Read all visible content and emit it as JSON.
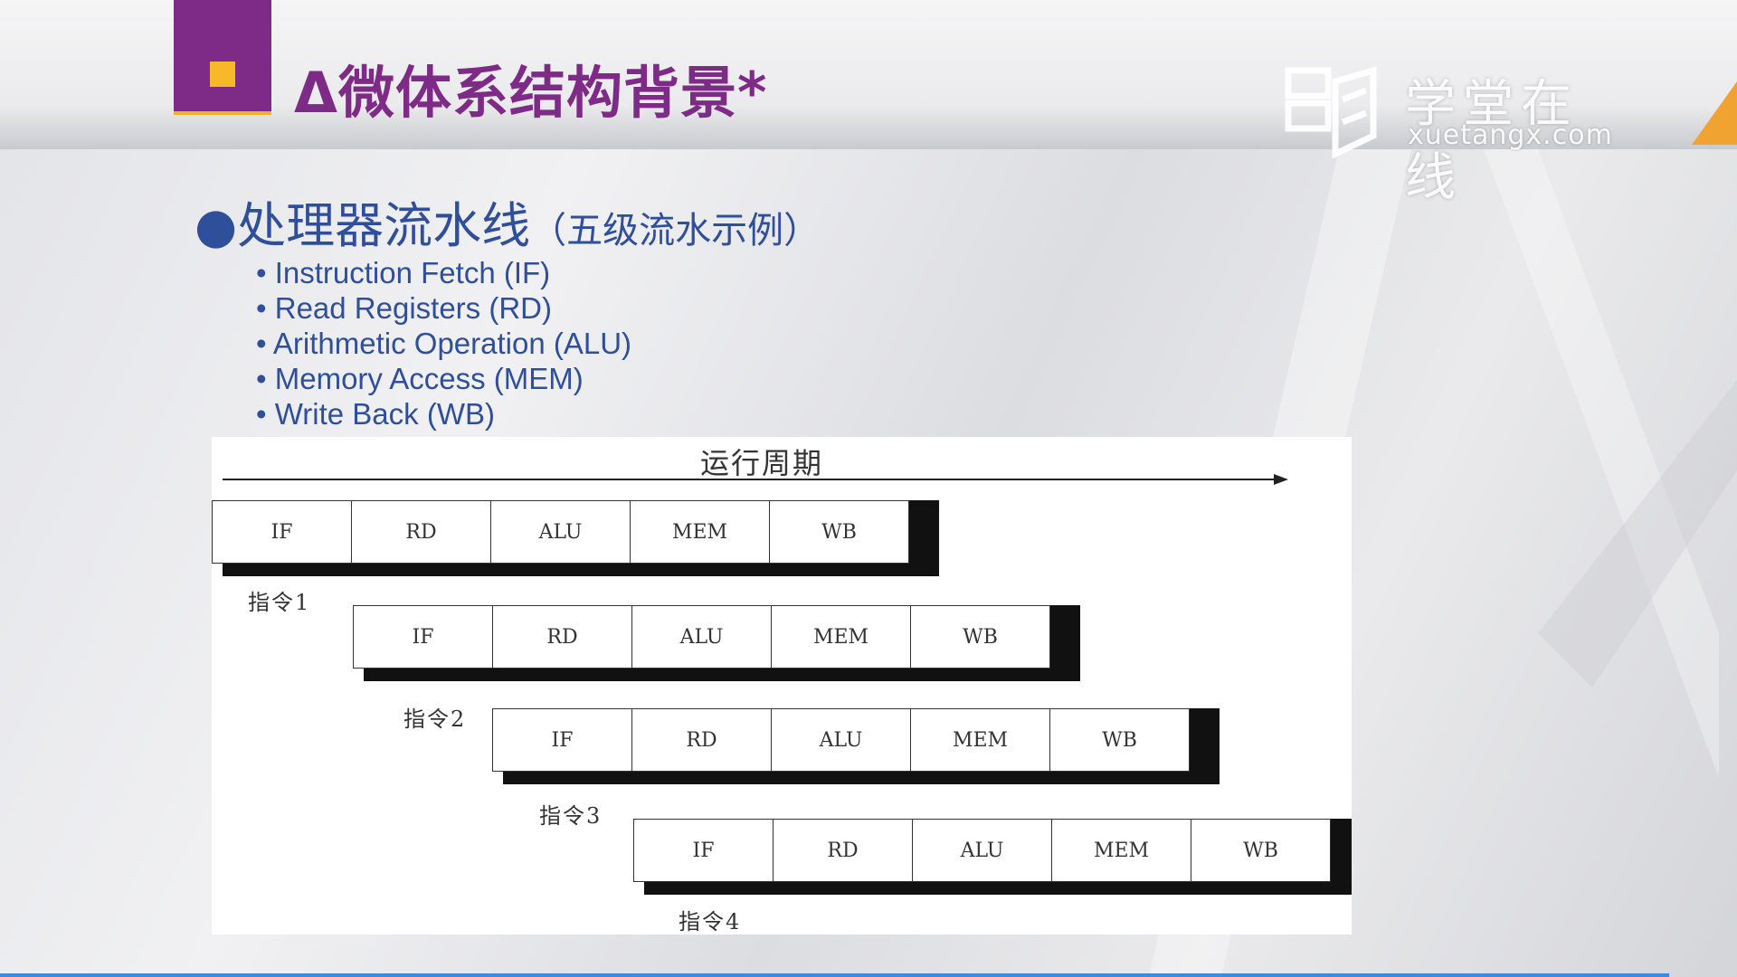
{
  "slide": {
    "title": "Δ微体系结构背景*",
    "heading": "●处理器流水线",
    "heading_sub": "（五级流水示例）",
    "bullets": [
      "Instruction Fetch (IF)",
      "Read Registers (RD)",
      "Arithmetic Operation (ALU)",
      "Memory Access (MEM)",
      "Write Back (WB)"
    ]
  },
  "logo": {
    "name": "学堂在线",
    "url": "xuetangx.com",
    "icon": "book-icon"
  },
  "diagram": {
    "axis_label": "运行周期",
    "stages": [
      "IF",
      "RD",
      "ALU",
      "MEM",
      "WB"
    ],
    "instructions": [
      "指令1",
      "指令2",
      "指令3",
      "指令4"
    ]
  },
  "colors": {
    "title_purple": "#7e2a87",
    "accent_yellow": "#f7b928",
    "heading_blue": "#2f4f9a",
    "corner_orange": "#f0a330"
  }
}
